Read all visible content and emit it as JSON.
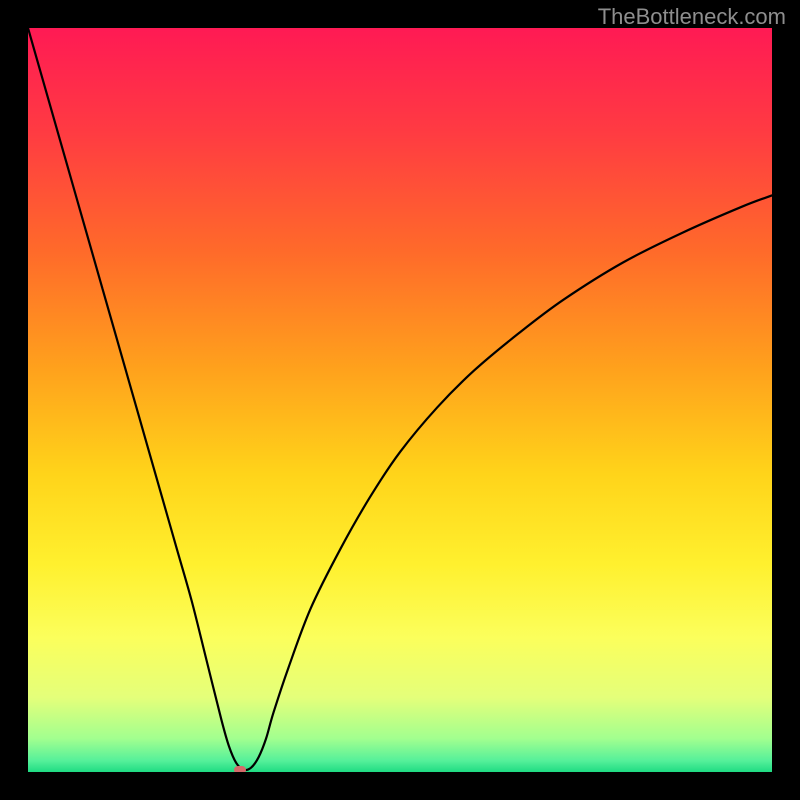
{
  "watermark": "TheBottleneck.com",
  "chart_data": {
    "type": "line",
    "title": "",
    "xlabel": "",
    "ylabel": "",
    "xlim": [
      0,
      100
    ],
    "ylim": [
      0,
      100
    ],
    "grid": false,
    "background_gradient": {
      "stops": [
        {
          "offset": 0.0,
          "color": "#ff1a54"
        },
        {
          "offset": 0.14,
          "color": "#ff3b42"
        },
        {
          "offset": 0.3,
          "color": "#ff6a2a"
        },
        {
          "offset": 0.46,
          "color": "#ffa21c"
        },
        {
          "offset": 0.6,
          "color": "#ffd41a"
        },
        {
          "offset": 0.72,
          "color": "#fff02e"
        },
        {
          "offset": 0.82,
          "color": "#fbff5c"
        },
        {
          "offset": 0.9,
          "color": "#e4ff7a"
        },
        {
          "offset": 0.955,
          "color": "#a2ff8f"
        },
        {
          "offset": 0.985,
          "color": "#55f09a"
        },
        {
          "offset": 1.0,
          "color": "#1fdb83"
        }
      ]
    },
    "series": [
      {
        "name": "bottleneck-curve",
        "color": "#000000",
        "x": [
          0,
          2,
          4,
          6,
          8,
          10,
          12,
          14,
          16,
          18,
          20,
          22,
          24,
          26,
          27,
          28,
          29,
          30,
          31,
          32,
          33,
          35,
          38,
          42,
          46,
          50,
          55,
          60,
          66,
          72,
          80,
          88,
          96,
          100
        ],
        "y": [
          100,
          93,
          86,
          79,
          72,
          65,
          58,
          51,
          44,
          37,
          30,
          23,
          15,
          7,
          3.5,
          1.2,
          0.3,
          0.6,
          2,
          4.5,
          8,
          14,
          22,
          30,
          37,
          43,
          49,
          54,
          59,
          63.5,
          68.5,
          72.5,
          76,
          77.5
        ]
      }
    ],
    "marker": {
      "x": 28.5,
      "y": 0.3,
      "color": "#d46a6a"
    }
  }
}
